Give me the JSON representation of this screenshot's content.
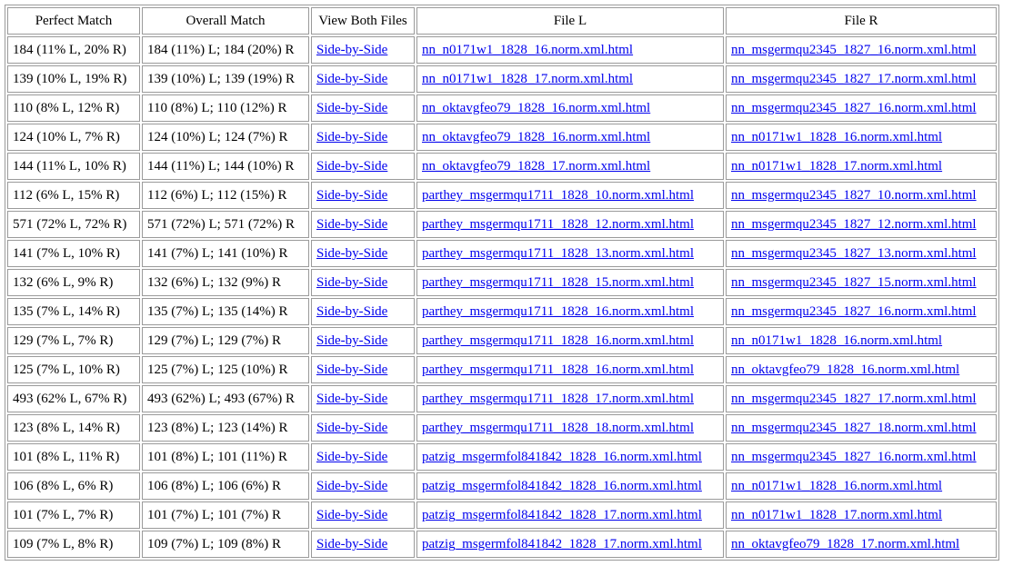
{
  "headers": {
    "perfect_match": "Perfect Match",
    "overall_match": "Overall Match",
    "view_both": "View Both Files",
    "file_l": "File L",
    "file_r": "File R"
  },
  "rows": [
    {
      "perfect": "184 (11% L, 20% R)",
      "overall": "184 (11%) L; 184 (20%) R",
      "view": "Side-by-Side",
      "file_l": "nn_n0171w1_1828_16.norm.xml.html",
      "file_r": "nn_msgermqu2345_1827_16.norm.xml.html"
    },
    {
      "perfect": "139 (10% L, 19% R)",
      "overall": "139 (10%) L; 139 (19%) R",
      "view": "Side-by-Side",
      "file_l": "nn_n0171w1_1828_17.norm.xml.html",
      "file_r": "nn_msgermqu2345_1827_17.norm.xml.html"
    },
    {
      "perfect": "110 (8% L, 12% R)",
      "overall": "110 (8%) L; 110 (12%) R",
      "view": "Side-by-Side",
      "file_l": "nn_oktavgfeo79_1828_16.norm.xml.html",
      "file_r": "nn_msgermqu2345_1827_16.norm.xml.html"
    },
    {
      "perfect": "124 (10% L, 7% R)",
      "overall": "124 (10%) L; 124 (7%) R",
      "view": "Side-by-Side",
      "file_l": "nn_oktavgfeo79_1828_16.norm.xml.html",
      "file_r": "nn_n0171w1_1828_16.norm.xml.html"
    },
    {
      "perfect": "144 (11% L, 10% R)",
      "overall": "144 (11%) L; 144 (10%) R",
      "view": "Side-by-Side",
      "file_l": "nn_oktavgfeo79_1828_17.norm.xml.html",
      "file_r": "nn_n0171w1_1828_17.norm.xml.html"
    },
    {
      "perfect": "112 (6% L, 15% R)",
      "overall": "112 (6%) L; 112 (15%) R",
      "view": "Side-by-Side",
      "file_l": "parthey_msgermqu1711_1828_10.norm.xml.html",
      "file_r": "nn_msgermqu2345_1827_10.norm.xml.html"
    },
    {
      "perfect": "571 (72% L, 72% R)",
      "overall": "571 (72%) L; 571 (72%) R",
      "view": "Side-by-Side",
      "file_l": "parthey_msgermqu1711_1828_12.norm.xml.html",
      "file_r": "nn_msgermqu2345_1827_12.norm.xml.html"
    },
    {
      "perfect": "141 (7% L, 10% R)",
      "overall": "141 (7%) L; 141 (10%) R",
      "view": "Side-by-Side",
      "file_l": "parthey_msgermqu1711_1828_13.norm.xml.html",
      "file_r": "nn_msgermqu2345_1827_13.norm.xml.html"
    },
    {
      "perfect": "132 (6% L, 9% R)",
      "overall": "132 (6%) L; 132 (9%) R",
      "view": "Side-by-Side",
      "file_l": "parthey_msgermqu1711_1828_15.norm.xml.html",
      "file_r": "nn_msgermqu2345_1827_15.norm.xml.html"
    },
    {
      "perfect": "135 (7% L, 14% R)",
      "overall": "135 (7%) L; 135 (14%) R",
      "view": "Side-by-Side",
      "file_l": "parthey_msgermqu1711_1828_16.norm.xml.html",
      "file_r": "nn_msgermqu2345_1827_16.norm.xml.html"
    },
    {
      "perfect": "129 (7% L, 7% R)",
      "overall": "129 (7%) L; 129 (7%) R",
      "view": "Side-by-Side",
      "file_l": "parthey_msgermqu1711_1828_16.norm.xml.html",
      "file_r": "nn_n0171w1_1828_16.norm.xml.html"
    },
    {
      "perfect": "125 (7% L, 10% R)",
      "overall": "125 (7%) L; 125 (10%) R",
      "view": "Side-by-Side",
      "file_l": "parthey_msgermqu1711_1828_16.norm.xml.html",
      "file_r": "nn_oktavgfeo79_1828_16.norm.xml.html"
    },
    {
      "perfect": "493 (62% L, 67% R)",
      "overall": "493 (62%) L; 493 (67%) R",
      "view": "Side-by-Side",
      "file_l": "parthey_msgermqu1711_1828_17.norm.xml.html",
      "file_r": "nn_msgermqu2345_1827_17.norm.xml.html"
    },
    {
      "perfect": "123 (8% L, 14% R)",
      "overall": "123 (8%) L; 123 (14%) R",
      "view": "Side-by-Side",
      "file_l": "parthey_msgermqu1711_1828_18.norm.xml.html",
      "file_r": "nn_msgermqu2345_1827_18.norm.xml.html"
    },
    {
      "perfect": "101 (8% L, 11% R)",
      "overall": "101 (8%) L; 101 (11%) R",
      "view": "Side-by-Side",
      "file_l": "patzig_msgermfol841842_1828_16.norm.xml.html",
      "file_r": "nn_msgermqu2345_1827_16.norm.xml.html"
    },
    {
      "perfect": "106 (8% L, 6% R)",
      "overall": "106 (8%) L; 106 (6%) R",
      "view": "Side-by-Side",
      "file_l": "patzig_msgermfol841842_1828_16.norm.xml.html",
      "file_r": "nn_n0171w1_1828_16.norm.xml.html"
    },
    {
      "perfect": "101 (7% L, 7% R)",
      "overall": "101 (7%) L; 101 (7%) R",
      "view": "Side-by-Side",
      "file_l": "patzig_msgermfol841842_1828_17.norm.xml.html",
      "file_r": "nn_n0171w1_1828_17.norm.xml.html"
    },
    {
      "perfect": "109 (7% L, 8% R)",
      "overall": "109 (7%) L; 109 (8%) R",
      "view": "Side-by-Side",
      "file_l": "patzig_msgermfol841842_1828_17.norm.xml.html",
      "file_r": "nn_oktavgfeo79_1828_17.norm.xml.html"
    }
  ]
}
